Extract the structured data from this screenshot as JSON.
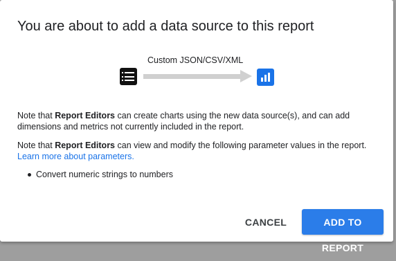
{
  "dialog": {
    "title": "You are about to add a data source to this report",
    "connector_label": "Custom JSON/CSV/XML",
    "source_icon": "data-source-list-icon",
    "target_icon": "report-bar-chart-icon",
    "note1": {
      "prefix": "Note that ",
      "bold": "Report Editors",
      "suffix": " can create charts using the new data source(s), and can add dimensions and metrics not currently included in the report."
    },
    "note2": {
      "prefix": "Note that ",
      "bold": "Report Editors",
      "suffix": " can view and modify the following parameter values in the report.",
      "link": "Learn more about parameters."
    },
    "parameters": [
      "Convert numeric strings to numbers"
    ],
    "buttons": {
      "cancel": "CANCEL",
      "add": "ADD TO REPORT"
    }
  },
  "colors": {
    "accent": "#1a73e8",
    "primary_button": "#2b7de9",
    "arrow": "#d0d0d0"
  }
}
